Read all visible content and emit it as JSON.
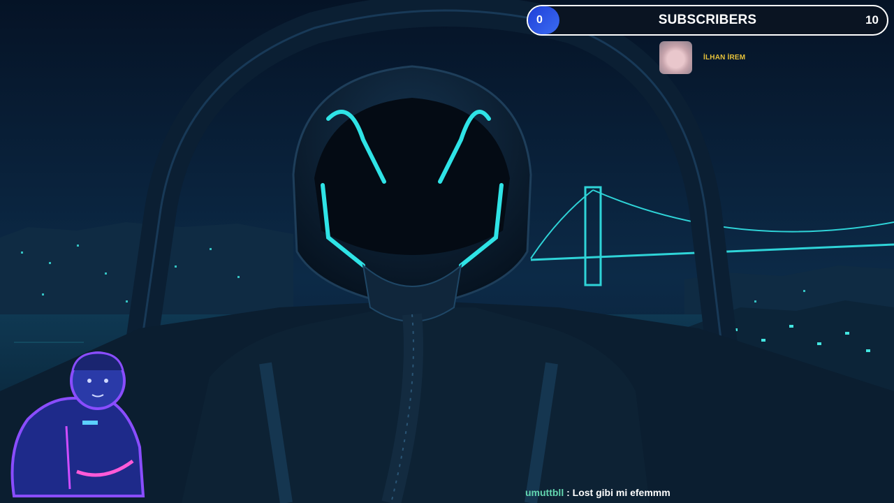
{
  "subscriber_widget": {
    "current": "0",
    "title": "SUBSCRIBERS",
    "goal": "10"
  },
  "recent_subscriber": {
    "name": "İLHAN İREM"
  },
  "chat": {
    "username": "umuttbll",
    "separator": ":",
    "message": "Lost gibi mi efemmm"
  },
  "colors": {
    "accent_cyan": "#2fe3e6",
    "counter_blue": "#2a52e6",
    "name_gold": "#e6c23a",
    "chat_user_green": "#63d6b0",
    "avatar_neon_purple": "#8a4dff"
  },
  "icons": {
    "background": "pilot-cockpit-night-bridge-artwork",
    "mascot": "neon-pilot-mascot-icon"
  }
}
